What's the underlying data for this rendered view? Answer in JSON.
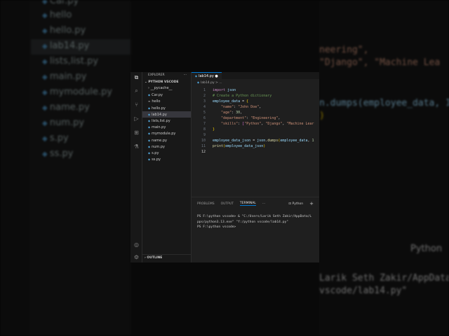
{
  "background": {
    "files": [
      "Car.py",
      "hello",
      "hello.py",
      "lab14.py",
      "lists,list.py",
      "main.py",
      "mymodule.py",
      "name.py",
      "num.py",
      "s.py",
      "ss.py"
    ],
    "code": [
      "neering\",",
      "\"Django\", \"Machine Lea",
      "n.dumps(employee_data, 1",
      ")"
    ],
    "terminal": [
      "Python",
      "Larik Seth Zakir/AppData/L",
      "vscode/lab14.py\""
    ]
  },
  "activity_bar": [
    "explorer",
    "search",
    "source-control",
    "run-debug",
    "extensions",
    "testing",
    "accounts",
    "settings"
  ],
  "sidebar": {
    "title": "EXPLORER",
    "more": "···",
    "project": "PYTHON VSCODE",
    "items": [
      {
        "label": "__pycache__",
        "type": "folder"
      },
      {
        "label": "Car.py"
      },
      {
        "label": "hello"
      },
      {
        "label": "hello.py"
      },
      {
        "label": "lab14.py",
        "selected": true
      },
      {
        "label": "lists,list.py"
      },
      {
        "label": "main.py"
      },
      {
        "label": "mymodule.py"
      },
      {
        "label": "name.py"
      },
      {
        "label": "num.py"
      },
      {
        "label": "s.py"
      },
      {
        "label": "ss.py"
      }
    ],
    "outline": "OUTLINE"
  },
  "editor": {
    "tab": "lab14.py",
    "breadcrumb": "lab14.py > ...",
    "lines": [
      "1",
      "2",
      "3",
      "4",
      "5",
      "6",
      "7",
      "8",
      "9",
      "10",
      "11",
      "12"
    ],
    "code": {
      "l1a": "import",
      "l1b": " json",
      "l2": "# Create a Python dictionary",
      "l3a": "employee_data",
      " l3b": "",
      "l4k": "\"name\"",
      "l4v": "\"John Doe\"",
      "l5k": "\"age\"",
      "l5v": "30",
      "l6k": "\"department\"",
      "l6v": "\"Engineering\"",
      "l7k": "\"skills\"",
      "l7a": "\"Python\"",
      "l7b": "\"Django\"",
      "l7c": "\"Machine Lear",
      "l10a": "employee_data_json",
      "l10b": "json",
      "l10c": "dumps",
      "l10d": "employee_data",
      "l10e": " 1",
      "l11a": "print",
      "l11b": "employee_data_json"
    }
  },
  "panel": {
    "tabs": [
      "PROBLEMS",
      "OUTPUT",
      "TERMINAL"
    ],
    "active": "TERMINAL",
    "more": "···",
    "profile": "Python",
    "add": "+",
    "terminal": [
      "PS F:\\python vscode> & \"C:/Users/Larik Seth Zakir/AppData/L",
      "pps/python3.13.exe\" \"f:/python vscode/lab14.py\"",
      "PS F:\\python vscode>"
    ]
  }
}
